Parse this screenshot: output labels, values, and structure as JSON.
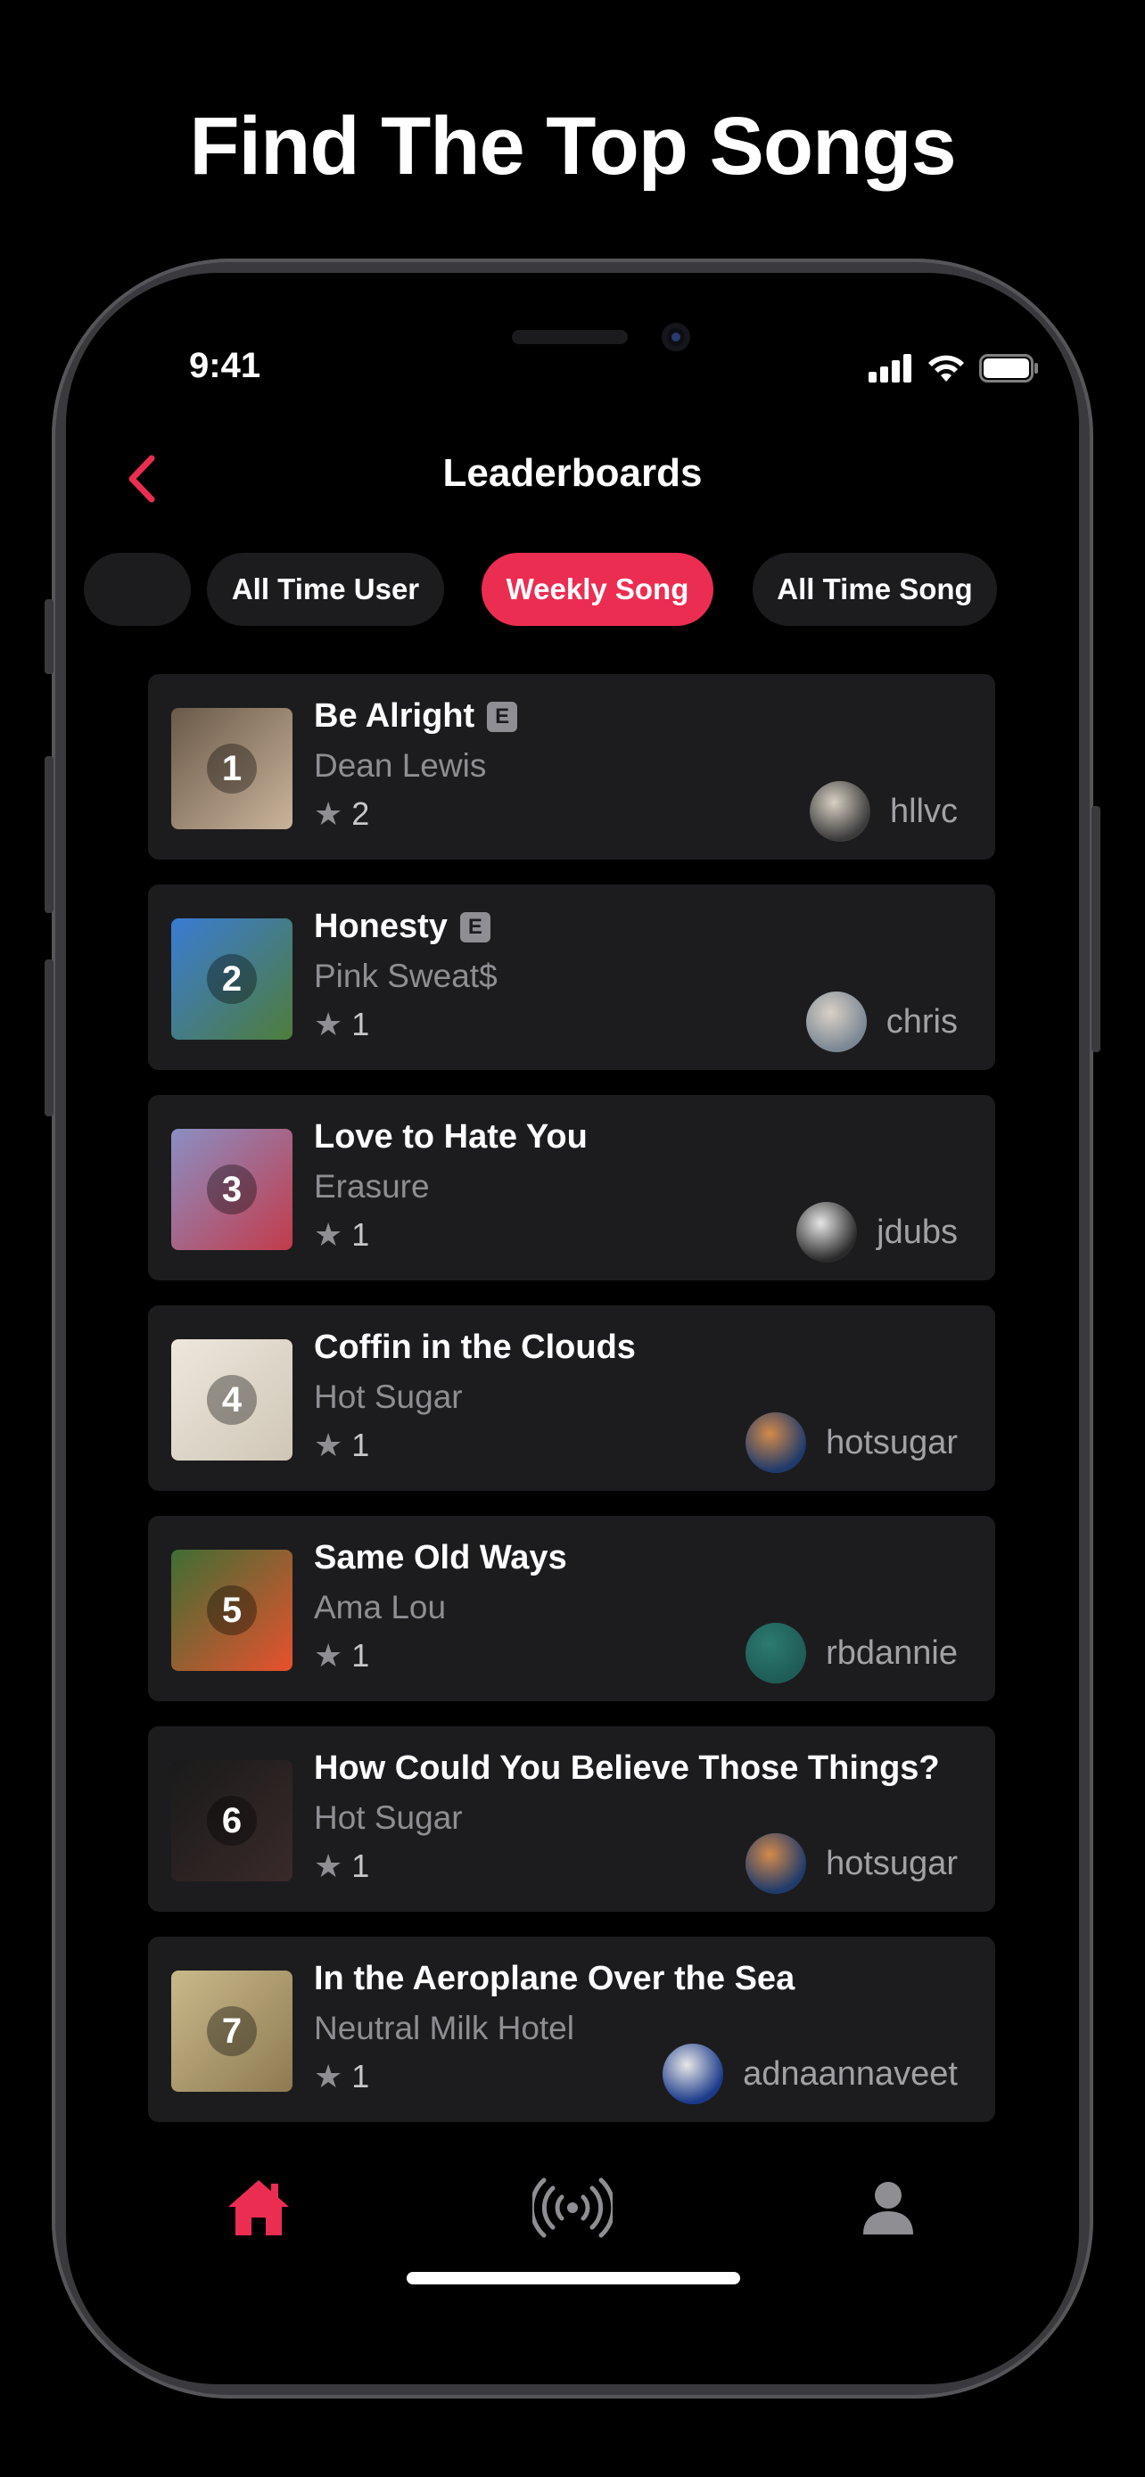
{
  "headline": "Find The Top Songs",
  "status": {
    "time": "9:41"
  },
  "nav": {
    "title": "Leaderboards",
    "back_icon": "chevron-left-icon"
  },
  "tabs": [
    {
      "label": "All Time User",
      "active": false
    },
    {
      "label": "Weekly Song",
      "active": true
    },
    {
      "label": "All Time Song",
      "active": false
    }
  ],
  "songs": [
    {
      "rank": "1",
      "title": "Be Alright",
      "explicit": true,
      "explicit_label": "E",
      "artist": "Dean Lewis",
      "stars": "2",
      "user": "hllvc",
      "art_colors": [
        "#6b5a4a",
        "#c9b39a"
      ],
      "avatar_colors": [
        "#3b3b3b",
        "#d8d0c4"
      ]
    },
    {
      "rank": "2",
      "title": "Honesty",
      "explicit": true,
      "explicit_label": "E",
      "artist": "Pink Sweat$",
      "stars": "1",
      "user": "chris",
      "art_colors": [
        "#3a7bd5",
        "#4f7d3b"
      ],
      "avatar_colors": [
        "#7b8794",
        "#d9d1c6"
      ]
    },
    {
      "rank": "3",
      "title": "Love to Hate You",
      "explicit": false,
      "explicit_label": "",
      "artist": "Erasure",
      "stars": "1",
      "user": "jdubs",
      "art_colors": [
        "#8a8fc4",
        "#c33b4a"
      ],
      "avatar_colors": [
        "#2a2a2a",
        "#e6e6e6"
      ]
    },
    {
      "rank": "4",
      "title": "Coffin in the Clouds",
      "explicit": false,
      "explicit_label": "",
      "artist": "Hot Sugar",
      "stars": "1",
      "user": "hotsugar",
      "art_colors": [
        "#ede7dc",
        "#cfc6b6"
      ],
      "avatar_colors": [
        "#1f3a6b",
        "#d38a4a"
      ]
    },
    {
      "rank": "5",
      "title": "Same Old Ways",
      "explicit": false,
      "explicit_label": "",
      "artist": "Ama Lou",
      "stars": "1",
      "user": "rbdannie",
      "art_colors": [
        "#3f6e34",
        "#e8512e"
      ],
      "avatar_colors": [
        "#1f5c56",
        "#2c7a70"
      ]
    },
    {
      "rank": "6",
      "title": "How Could You Believe Those Things?",
      "explicit": false,
      "explicit_label": "",
      "artist": "Hot Sugar",
      "stars": "1",
      "user": "hotsugar",
      "art_colors": [
        "#1a1a1a",
        "#3a2a2a"
      ],
      "avatar_colors": [
        "#1f3a6b",
        "#d38a4a"
      ]
    },
    {
      "rank": "7",
      "title": "In the Aeroplane Over the Sea",
      "explicit": false,
      "explicit_label": "",
      "artist": "Neutral Milk Hotel",
      "stars": "1",
      "user": "adnaannaveet",
      "art_colors": [
        "#c9b98a",
        "#8d7a52"
      ],
      "avatar_colors": [
        "#1b3a8a",
        "#e8e8e8"
      ]
    }
  ],
  "tabbar": [
    {
      "name": "home",
      "icon": "home-icon",
      "active": true
    },
    {
      "name": "broadcast",
      "icon": "broadcast-icon",
      "active": false
    },
    {
      "name": "profile",
      "icon": "person-icon",
      "active": false
    }
  ],
  "colors": {
    "accent": "#ec2d52",
    "card": "#1c1c1e",
    "secondary_text": "#8e8e93"
  }
}
